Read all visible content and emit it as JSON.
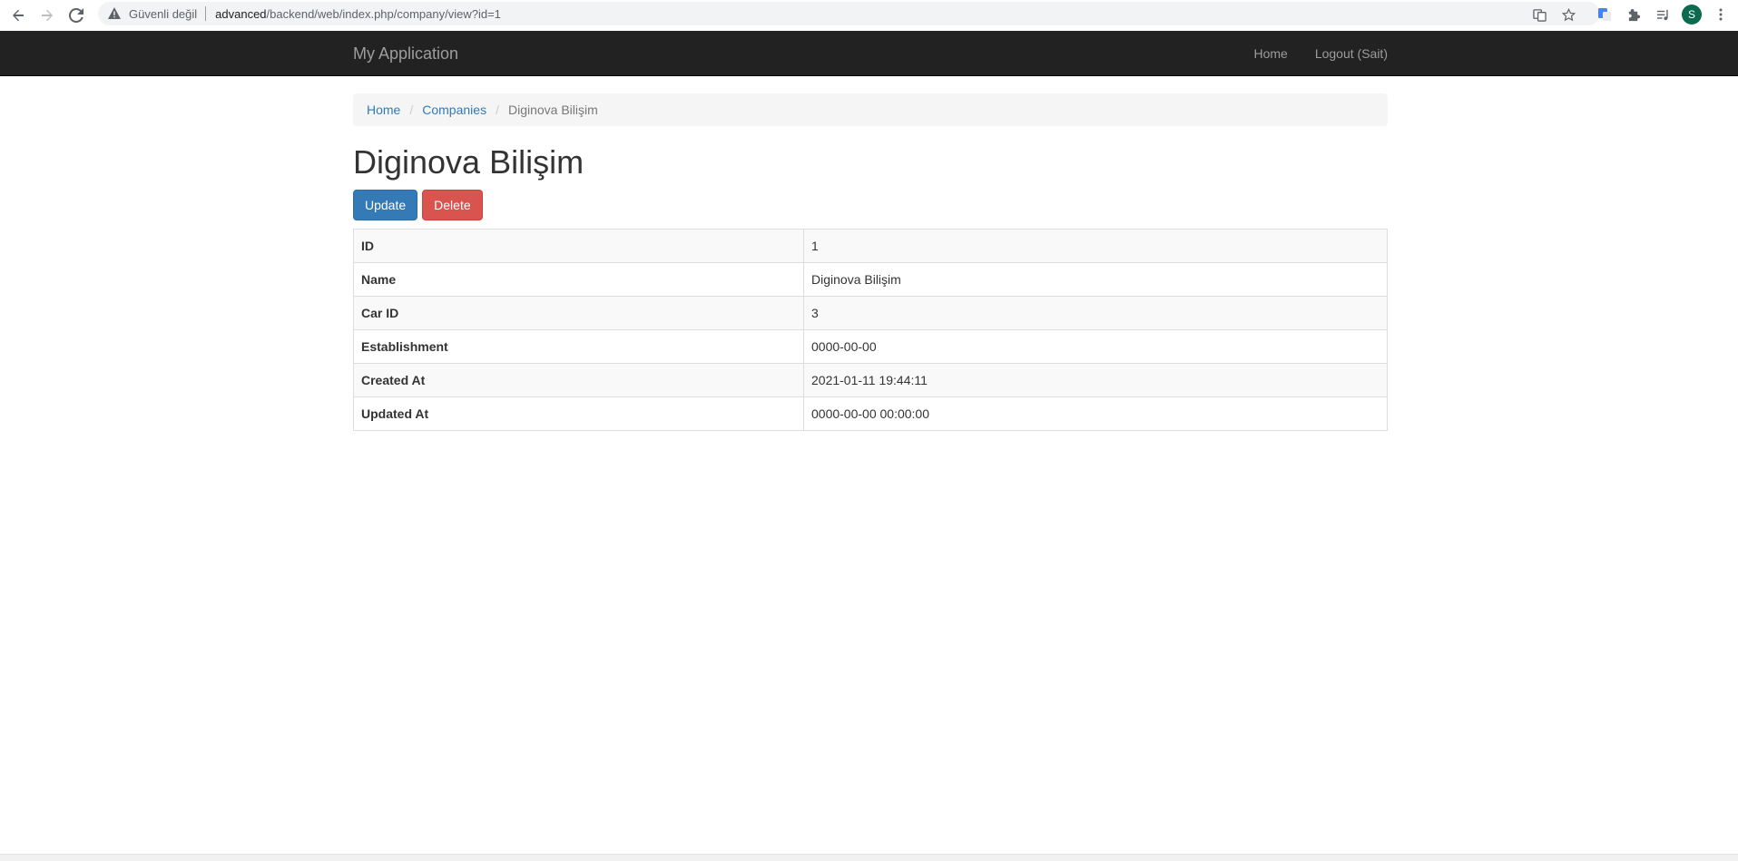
{
  "browser": {
    "security_text": "Güvenli değil",
    "url_host": "advanced",
    "url_path": "/backend/web/index.php/company/view?id=1",
    "profile_initial": "S"
  },
  "navbar": {
    "brand": "My Application",
    "links": [
      "Home",
      "Logout (Sait)"
    ]
  },
  "breadcrumb": [
    "Home",
    "Companies",
    "Diginova Bilişim"
  ],
  "page": {
    "title": "Diginova Bilişim",
    "update_label": "Update",
    "delete_label": "Delete"
  },
  "details": [
    {
      "label": "ID",
      "value": "1"
    },
    {
      "label": "Name",
      "value": "Diginova Bilişim"
    },
    {
      "label": "Car ID",
      "value": "3"
    },
    {
      "label": "Establishment",
      "value": "0000-00-00"
    },
    {
      "label": "Created At",
      "value": "2021-01-11 19:44:11"
    },
    {
      "label": "Updated At",
      "value": "0000-00-00 00:00:00"
    }
  ],
  "colors": {
    "navbar_bg": "#222222",
    "primary": "#337ab7",
    "danger": "#d9534f",
    "link": "#337ab7"
  }
}
